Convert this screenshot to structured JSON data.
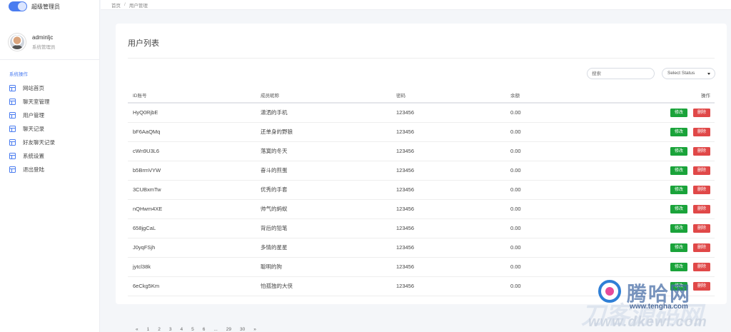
{
  "brand": {
    "title": "超级管理员"
  },
  "user": {
    "name": "adminljc",
    "role": "系统管理员"
  },
  "nav": {
    "section": "系统操作",
    "items": [
      {
        "label": "网站首页",
        "icon": "layout-icon"
      },
      {
        "label": "聊天室管理",
        "icon": "layout-icon"
      },
      {
        "label": "用户管理",
        "icon": "layout-icon"
      },
      {
        "label": "聊天记录",
        "icon": "layout-icon"
      },
      {
        "label": "好友聊天记录",
        "icon": "layout-icon"
      },
      {
        "label": "系统设置",
        "icon": "layout-icon"
      },
      {
        "label": "退出登陆",
        "icon": "layout-icon"
      }
    ]
  },
  "breadcrumb": {
    "home": "首页",
    "sep": "/",
    "current": "用户管理"
  },
  "card": {
    "title": "用户列表"
  },
  "filters": {
    "search_placeholder": "搜索",
    "status_selected": "Select Status"
  },
  "table": {
    "headers": {
      "id": "ID账号",
      "nickname": "成员昵称",
      "password": "密码",
      "balance": "余额",
      "actions": "操作"
    },
    "edit_label": "修改",
    "delete_label": "删除",
    "rows": [
      {
        "id": "HyQ0RjbE",
        "nickname": "潇洒的手机",
        "password": "123456",
        "balance": "0.00"
      },
      {
        "id": "bF6AaQMq",
        "nickname": "还单身的野狼",
        "password": "123456",
        "balance": "0.00"
      },
      {
        "id": "cWn9U3L6",
        "nickname": "落寞的冬天",
        "password": "123456",
        "balance": "0.00"
      },
      {
        "id": "b5BrmVYW",
        "nickname": "奋斗的煎蛋",
        "password": "123456",
        "balance": "0.00"
      },
      {
        "id": "3CUBxmTw",
        "nickname": "优秀的手套",
        "password": "123456",
        "balance": "0.00"
      },
      {
        "id": "nQHwm4XE",
        "nickname": "帅气的蚂蚁",
        "password": "123456",
        "balance": "0.00"
      },
      {
        "id": "658jgCaL",
        "nickname": "背后的铅笔",
        "password": "123456",
        "balance": "0.00"
      },
      {
        "id": "J0yqFSjh",
        "nickname": "多情的星星",
        "password": "123456",
        "balance": "0.00"
      },
      {
        "id": "jytcl38k",
        "nickname": "聪明的狗",
        "password": "123456",
        "balance": "0.00"
      },
      {
        "id": "6eCkg5Km",
        "nickname": "怕孤独的大侠",
        "password": "123456",
        "balance": "0.00"
      }
    ]
  },
  "pagination": [
    "«",
    "1",
    "2",
    "3",
    "4",
    "5",
    "6",
    "...",
    "29",
    "30",
    "»"
  ],
  "watermark": {
    "cn": "腾哈网",
    "url1": "www.tengha.com",
    "big": "刀客源码网",
    "url2": "www.dkewl.com"
  }
}
